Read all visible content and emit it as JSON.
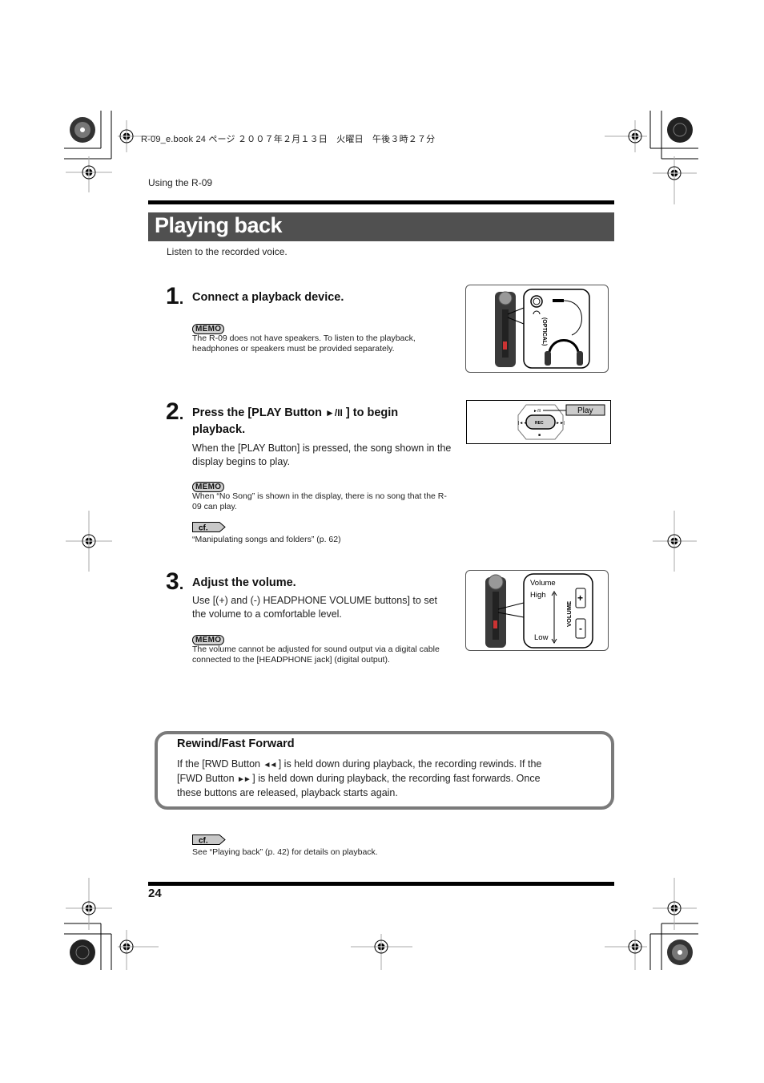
{
  "print_header": {
    "job_line": "R-09_e.book  24 ページ  ２００７年２月１３日　火曜日　午後３時２７分"
  },
  "running_header": "Using the R-09",
  "section": {
    "title": "Playing back",
    "intro": "Listen to the recorded voice."
  },
  "labels": {
    "memo": "MEMO",
    "cf": "cf."
  },
  "steps": [
    {
      "number": "1",
      "heading": "Connect a playback device.",
      "body": "",
      "memo": "The R-09 does not have speakers. To listen to the playback, headphones or speakers must be provided separately.",
      "figure": {
        "jack_label": "(OPTICAL)",
        "headphone_icon": "headphones-icon"
      }
    },
    {
      "number": "2",
      "heading_pre": "Press the [PLAY Button ",
      "heading_icon": "►/II",
      "heading_post": " ] to begin playback.",
      "body": "When the [PLAY Button] is pressed, the song shown in the display begins to play.",
      "memo": "When “No Song” is shown in the display, there is no song that the R-09 can play.",
      "cf": "“Manipulating songs and folders” (p. 62)",
      "figure": {
        "callout": "Play",
        "center_button": "REC",
        "top_button": "►/II",
        "left_button": "|◄◄",
        "right_button": "►►|",
        "bottom_button": "■"
      }
    },
    {
      "number": "3",
      "heading": "Adjust the volume.",
      "body": "Use [(+) and (-) HEADPHONE VOLUME buttons] to set the volume to a comfortable level.",
      "memo": "The volume cannot be adjusted for sound output via a digital cable connected to the [HEADPHONE jack] (digital output).",
      "figure": {
        "title": "Volume",
        "high": "High",
        "low": "Low",
        "side_label": "VOLUME",
        "plus": "+",
        "minus": "-"
      }
    }
  ],
  "tip_box": {
    "heading": "Rewind/Fast Forward",
    "line1_pre": "If the [RWD Button ",
    "rwd_icon": "◄◄",
    "line1_post": " ] is held down during playback, the recording rewinds. If the",
    "line2_pre": "[FWD Button ",
    "fwd_icon": "►►",
    "line2_post": " ] is held down during playback, the recording fast forwards. Once",
    "line3": "these buttons are released, playback starts again."
  },
  "footer_cf": "See “Playing back” (p. 42) for details on playback.",
  "page_number": "24"
}
